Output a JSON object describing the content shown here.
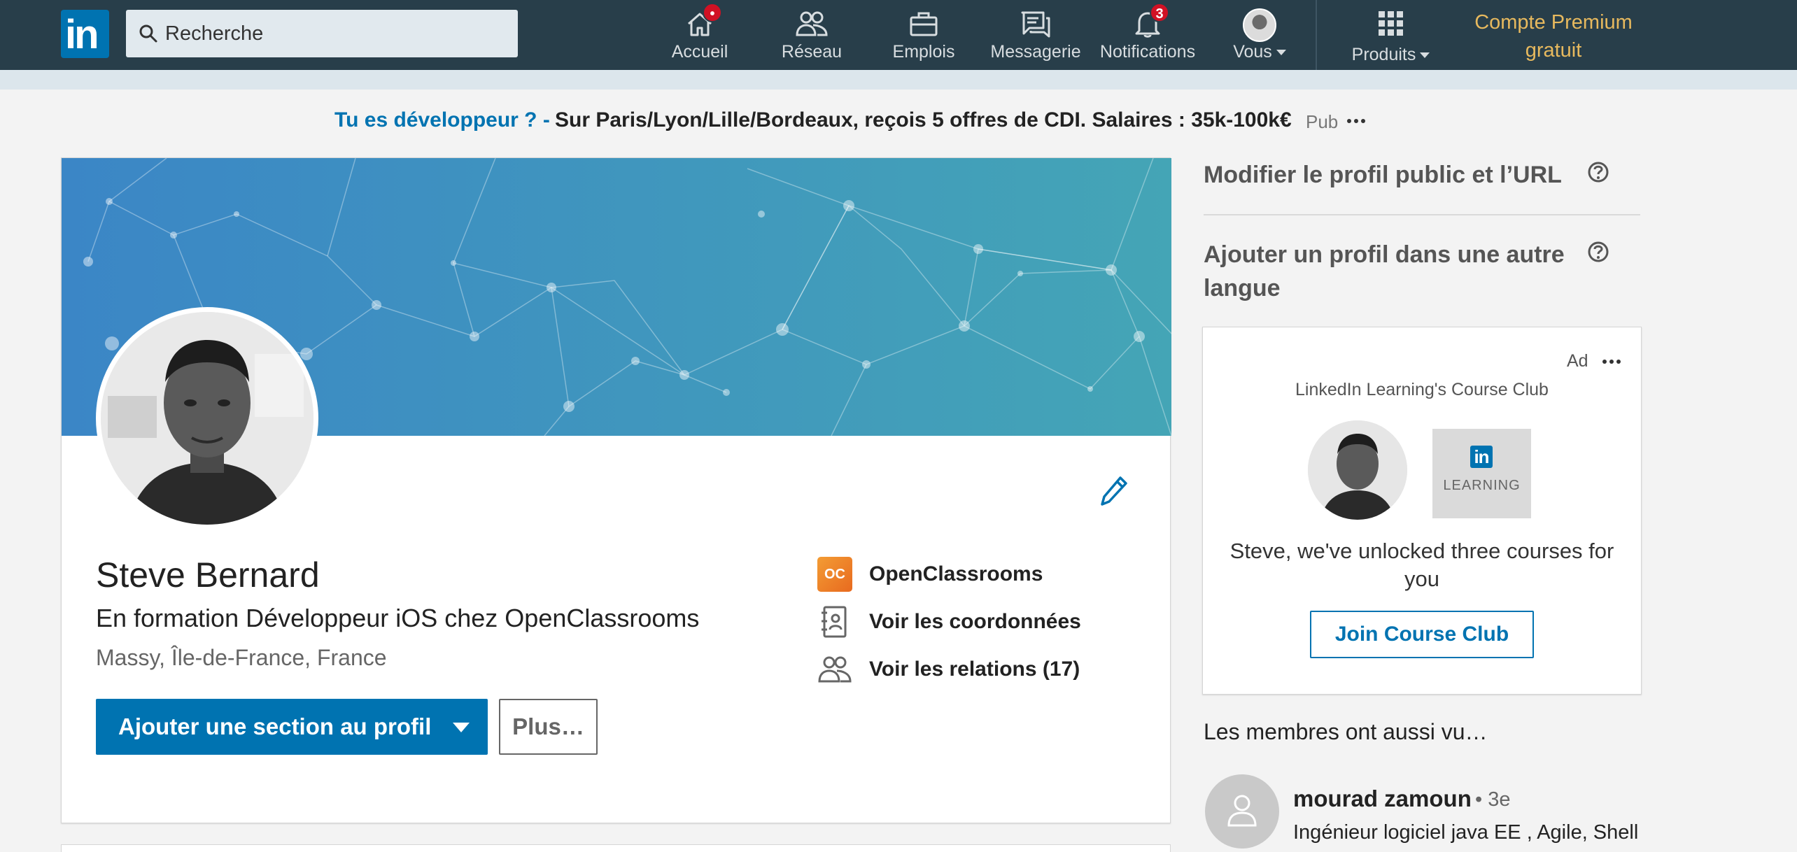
{
  "nav": {
    "search_placeholder": "Recherche",
    "items": [
      {
        "label": "Accueil",
        "icon": "home-icon",
        "badge": "•"
      },
      {
        "label": "Réseau",
        "icon": "network-icon"
      },
      {
        "label": "Emplois",
        "icon": "briefcase-icon"
      },
      {
        "label": "Messagerie",
        "icon": "messaging-icon"
      },
      {
        "label": "Notifications",
        "icon": "bell-icon",
        "badge": "3"
      },
      {
        "label": "Vous",
        "icon": "avatar"
      },
      {
        "label": "Produits",
        "icon": "grid-icon"
      }
    ],
    "premium_line1": "Compte Premium",
    "premium_line2": "gratuit",
    "brand_color": "#283e4a",
    "badge_color": "#d11124"
  },
  "promo": {
    "lead": "Tu es développeur ? -",
    "text": "Sur Paris/Lyon/Lille/Bordeaux, reçois 5 offres de CDI. Salaires : 35k-100k€",
    "tag": "Pub",
    "more": "···"
  },
  "profile": {
    "name": "Steve Bernard",
    "headline": "En formation Développeur iOS chez OpenClassrooms",
    "location": "Massy, Île-de-France, France",
    "primary_action": "Ajouter une section au profil",
    "secondary_action": "Plus…",
    "company": "OpenClassrooms",
    "company_logo_text": "OC",
    "contact_link": "Voir les coordonnées",
    "connections_link": "Voir les relations (17)",
    "accent_color": "#0073b1"
  },
  "rail": {
    "public_profile": "Modifier le profil public et l’URL",
    "other_language": "Ajouter un profil dans une autre langue",
    "ad": {
      "tag": "Ad",
      "more": "···",
      "sponsor": "LinkedIn Learning's Course Club",
      "learning_logo": "in",
      "learning_word": "LEARNING",
      "message": "Steve, we've unlocked three courses for you",
      "cta": "Join Course Club"
    },
    "also_viewed_title": "Les membres ont aussi vu…",
    "members": [
      {
        "name": "mourad zamoun",
        "degree": "• 3e",
        "title": "Ingénieur logiciel java EE , Agile, Shell"
      }
    ]
  }
}
